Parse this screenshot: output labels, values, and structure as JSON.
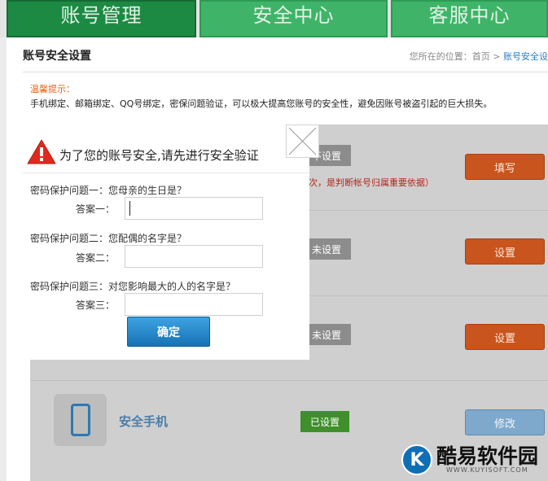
{
  "nav": {
    "tabs": [
      {
        "label": "账号管理"
      },
      {
        "label": "安全中心"
      },
      {
        "label": "客服中心"
      }
    ]
  },
  "page": {
    "title": "账号安全设置",
    "breadcrumb": {
      "prefix": "您所在的位置：首页 > ",
      "current": "账号安全设"
    },
    "tip_title": "温馨提示：",
    "tip_text": "手机绑定、邮箱绑定、QQ号绑定，密保问题验证，可以极大提高您账号的安全性，避免因账号被盗引起的巨大损失。"
  },
  "settings": {
    "rows": [
      {
        "status": "不设置",
        "action": "填写",
        "note": "次，是判断帐号归属重要依据）"
      },
      {
        "status": "未设置",
        "action": "设置"
      },
      {
        "status": "未设置",
        "action": "设置"
      },
      {
        "label": "安全手机",
        "status": "已设置",
        "action": "修改"
      }
    ]
  },
  "dialog": {
    "title": "为了您的账号安全,请先进行安全验证",
    "questions": [
      {
        "question": "密码保护问题一：您母亲的生日是？",
        "answer_label": "答案一：",
        "value": ""
      },
      {
        "question": "密码保护问题二：您配偶的名字是？",
        "answer_label": "答案二：",
        "value": ""
      },
      {
        "question": "密码保护问题三：对您影响最大的人的名字是？",
        "answer_label": "答案三：",
        "value": ""
      }
    ],
    "confirm_label": "确定"
  },
  "watermark": {
    "logo_letter": "K",
    "name": "酷易软件园",
    "url": "WWW.KUYISOFT.COM"
  },
  "colors": {
    "nav_active": "#1d8a44",
    "nav_normal": "#3fb468",
    "action_orange": "#c9541d",
    "confirm_blue": "#1672b6",
    "status_green": "#3f8f2b"
  }
}
